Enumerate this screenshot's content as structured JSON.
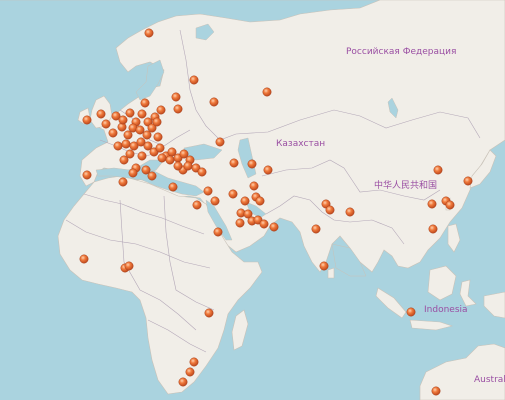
{
  "map": {
    "labels": {
      "russia": "Российская Федерация",
      "kazakhstan": "Казахстан",
      "china": "中华人民共和国",
      "indonesia": "Indonesia",
      "australia": "Australi"
    },
    "marker_count": 93
  },
  "colors": {
    "water": "#aad3df",
    "land": "#f1eee8",
    "border": "#b4a8b8",
    "marker": "#e8632b",
    "label": "#9a4fa3"
  }
}
